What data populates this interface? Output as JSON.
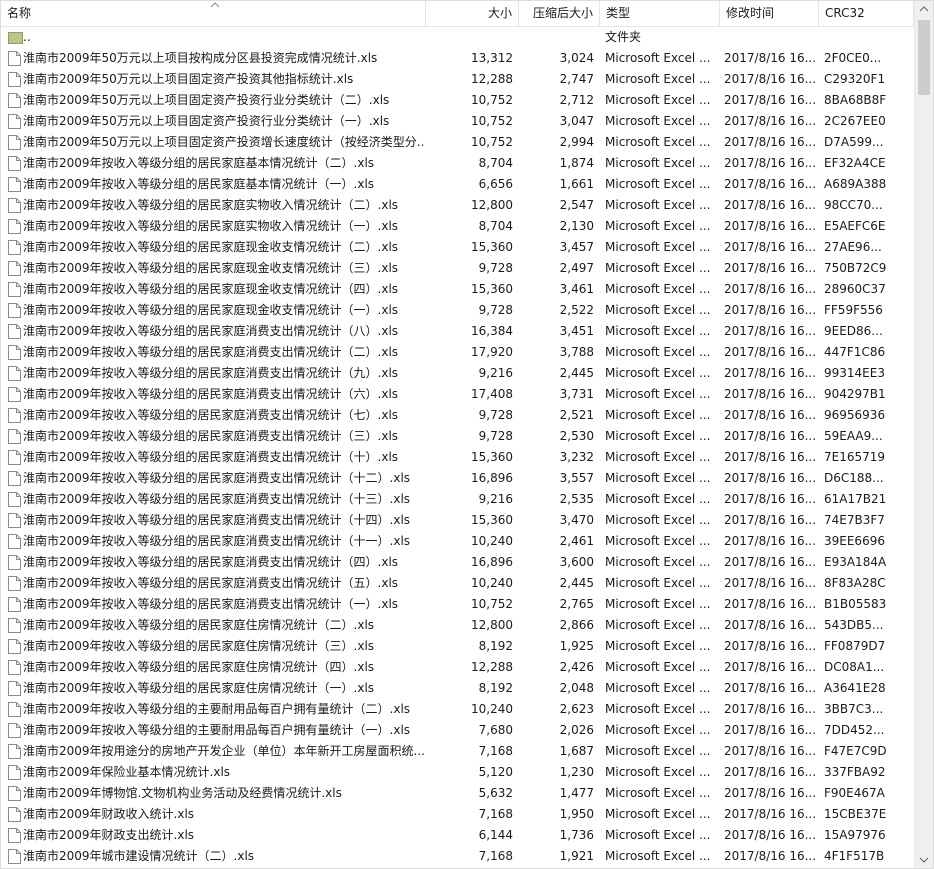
{
  "columns": {
    "name": "名称",
    "size": "大小",
    "compressed": "压缩后大小",
    "type": "类型",
    "modified": "修改时间",
    "crc": "CRC32"
  },
  "parent_row": {
    "name": "..",
    "type": "文件夹"
  },
  "files": [
    {
      "name": "淮南市2009年50万元以上项目按构成分区县投资完成情况统计.xls",
      "size": "13,312",
      "compressed": "3,024",
      "type": "Microsoft Excel ...",
      "modified": "2017/8/16 16...",
      "crc": "2F0CE0..."
    },
    {
      "name": "淮南市2009年50万元以上项目固定资产投资其他指标统计.xls",
      "size": "12,288",
      "compressed": "2,747",
      "type": "Microsoft Excel ...",
      "modified": "2017/8/16 16...",
      "crc": "C29320F1"
    },
    {
      "name": "淮南市2009年50万元以上项目固定资产投资行业分类统计（二）.xls",
      "size": "10,752",
      "compressed": "2,712",
      "type": "Microsoft Excel ...",
      "modified": "2017/8/16 16...",
      "crc": "8BA68B8F"
    },
    {
      "name": "淮南市2009年50万元以上项目固定资产投资行业分类统计（一）.xls",
      "size": "10,752",
      "compressed": "3,047",
      "type": "Microsoft Excel ...",
      "modified": "2017/8/16 16...",
      "crc": "2C267EE0"
    },
    {
      "name": "淮南市2009年50万元以上项目固定资产投资增长速度统计（按经济类型分...",
      "size": "10,752",
      "compressed": "2,994",
      "type": "Microsoft Excel ...",
      "modified": "2017/8/16 16...",
      "crc": "D7A599..."
    },
    {
      "name": "淮南市2009年按收入等级分组的居民家庭基本情况统计（二）.xls",
      "size": "8,704",
      "compressed": "1,874",
      "type": "Microsoft Excel ...",
      "modified": "2017/8/16 16...",
      "crc": "EF32A4CE"
    },
    {
      "name": "淮南市2009年按收入等级分组的居民家庭基本情况统计（一）.xls",
      "size": "6,656",
      "compressed": "1,661",
      "type": "Microsoft Excel ...",
      "modified": "2017/8/16 16...",
      "crc": "A689A388"
    },
    {
      "name": "淮南市2009年按收入等级分组的居民家庭实物收入情况统计（二）.xls",
      "size": "12,800",
      "compressed": "2,547",
      "type": "Microsoft Excel ...",
      "modified": "2017/8/16 16...",
      "crc": "98CC70..."
    },
    {
      "name": "淮南市2009年按收入等级分组的居民家庭实物收入情况统计（一）.xls",
      "size": "8,704",
      "compressed": "2,130",
      "type": "Microsoft Excel ...",
      "modified": "2017/8/16 16...",
      "crc": "E5AEFC6E"
    },
    {
      "name": "淮南市2009年按收入等级分组的居民家庭现金收支情况统计（二）.xls",
      "size": "15,360",
      "compressed": "3,457",
      "type": "Microsoft Excel ...",
      "modified": "2017/8/16 16...",
      "crc": "27AE96..."
    },
    {
      "name": "淮南市2009年按收入等级分组的居民家庭现金收支情况统计（三）.xls",
      "size": "9,728",
      "compressed": "2,497",
      "type": "Microsoft Excel ...",
      "modified": "2017/8/16 16...",
      "crc": "750B72C9"
    },
    {
      "name": "淮南市2009年按收入等级分组的居民家庭现金收支情况统计（四）.xls",
      "size": "15,360",
      "compressed": "3,461",
      "type": "Microsoft Excel ...",
      "modified": "2017/8/16 16...",
      "crc": "28960C37"
    },
    {
      "name": "淮南市2009年按收入等级分组的居民家庭现金收支情况统计（一）.xls",
      "size": "9,728",
      "compressed": "2,522",
      "type": "Microsoft Excel ...",
      "modified": "2017/8/16 16...",
      "crc": "FF59F556"
    },
    {
      "name": "淮南市2009年按收入等级分组的居民家庭消费支出情况统计（八）.xls",
      "size": "16,384",
      "compressed": "3,451",
      "type": "Microsoft Excel ...",
      "modified": "2017/8/16 16...",
      "crc": "9EED86..."
    },
    {
      "name": "淮南市2009年按收入等级分组的居民家庭消费支出情况统计（二）.xls",
      "size": "17,920",
      "compressed": "3,788",
      "type": "Microsoft Excel ...",
      "modified": "2017/8/16 16...",
      "crc": "447F1C86"
    },
    {
      "name": "淮南市2009年按收入等级分组的居民家庭消费支出情况统计（九）.xls",
      "size": "9,216",
      "compressed": "2,445",
      "type": "Microsoft Excel ...",
      "modified": "2017/8/16 16...",
      "crc": "99314EE3"
    },
    {
      "name": "淮南市2009年按收入等级分组的居民家庭消费支出情况统计（六）.xls",
      "size": "17,408",
      "compressed": "3,731",
      "type": "Microsoft Excel ...",
      "modified": "2017/8/16 16...",
      "crc": "904297B1"
    },
    {
      "name": "淮南市2009年按收入等级分组的居民家庭消费支出情况统计（七）.xls",
      "size": "9,728",
      "compressed": "2,521",
      "type": "Microsoft Excel ...",
      "modified": "2017/8/16 16...",
      "crc": "96956936"
    },
    {
      "name": "淮南市2009年按收入等级分组的居民家庭消费支出情况统计（三）.xls",
      "size": "9,728",
      "compressed": "2,530",
      "type": "Microsoft Excel ...",
      "modified": "2017/8/16 16...",
      "crc": "59EAA9..."
    },
    {
      "name": "淮南市2009年按收入等级分组的居民家庭消费支出情况统计（十）.xls",
      "size": "15,360",
      "compressed": "3,232",
      "type": "Microsoft Excel ...",
      "modified": "2017/8/16 16...",
      "crc": "7E165719"
    },
    {
      "name": "淮南市2009年按收入等级分组的居民家庭消费支出情况统计（十二）.xls",
      "size": "16,896",
      "compressed": "3,557",
      "type": "Microsoft Excel ...",
      "modified": "2017/8/16 16...",
      "crc": "D6C188..."
    },
    {
      "name": "淮南市2009年按收入等级分组的居民家庭消费支出情况统计（十三）.xls",
      "size": "9,216",
      "compressed": "2,535",
      "type": "Microsoft Excel ...",
      "modified": "2017/8/16 16...",
      "crc": "61A17B21"
    },
    {
      "name": "淮南市2009年按收入等级分组的居民家庭消费支出情况统计（十四）.xls",
      "size": "15,360",
      "compressed": "3,470",
      "type": "Microsoft Excel ...",
      "modified": "2017/8/16 16...",
      "crc": "74E7B3F7"
    },
    {
      "name": "淮南市2009年按收入等级分组的居民家庭消费支出情况统计（十一）.xls",
      "size": "10,240",
      "compressed": "2,461",
      "type": "Microsoft Excel ...",
      "modified": "2017/8/16 16...",
      "crc": "39EE6696"
    },
    {
      "name": "淮南市2009年按收入等级分组的居民家庭消费支出情况统计（四）.xls",
      "size": "16,896",
      "compressed": "3,600",
      "type": "Microsoft Excel ...",
      "modified": "2017/8/16 16...",
      "crc": "E93A184A"
    },
    {
      "name": "淮南市2009年按收入等级分组的居民家庭消费支出情况统计（五）.xls",
      "size": "10,240",
      "compressed": "2,445",
      "type": "Microsoft Excel ...",
      "modified": "2017/8/16 16...",
      "crc": "8F83A28C"
    },
    {
      "name": "淮南市2009年按收入等级分组的居民家庭消费支出情况统计（一）.xls",
      "size": "10,752",
      "compressed": "2,765",
      "type": "Microsoft Excel ...",
      "modified": "2017/8/16 16...",
      "crc": "B1B05583"
    },
    {
      "name": "淮南市2009年按收入等级分组的居民家庭住房情况统计（二）.xls",
      "size": "12,800",
      "compressed": "2,866",
      "type": "Microsoft Excel ...",
      "modified": "2017/8/16 16...",
      "crc": "543DB5..."
    },
    {
      "name": "淮南市2009年按收入等级分组的居民家庭住房情况统计（三）.xls",
      "size": "8,192",
      "compressed": "1,925",
      "type": "Microsoft Excel ...",
      "modified": "2017/8/16 16...",
      "crc": "FF0879D7"
    },
    {
      "name": "淮南市2009年按收入等级分组的居民家庭住房情况统计（四）.xls",
      "size": "12,288",
      "compressed": "2,426",
      "type": "Microsoft Excel ...",
      "modified": "2017/8/16 16...",
      "crc": "DC08A1..."
    },
    {
      "name": "淮南市2009年按收入等级分组的居民家庭住房情况统计（一）.xls",
      "size": "8,192",
      "compressed": "2,048",
      "type": "Microsoft Excel ...",
      "modified": "2017/8/16 16...",
      "crc": "A3641E28"
    },
    {
      "name": "淮南市2009年按收入等级分组的主要耐用品每百户拥有量统计（二）.xls",
      "size": "10,240",
      "compressed": "2,623",
      "type": "Microsoft Excel ...",
      "modified": "2017/8/16 16...",
      "crc": "3BB7C3..."
    },
    {
      "name": "淮南市2009年按收入等级分组的主要耐用品每百户拥有量统计（一）.xls",
      "size": "7,680",
      "compressed": "2,026",
      "type": "Microsoft Excel ...",
      "modified": "2017/8/16 16...",
      "crc": "7DD452..."
    },
    {
      "name": "淮南市2009年按用途分的房地产开发企业（单位）本年新开工房屋面积统...",
      "size": "7,168",
      "compressed": "1,687",
      "type": "Microsoft Excel ...",
      "modified": "2017/8/16 16...",
      "crc": "F47E7C9D"
    },
    {
      "name": "淮南市2009年保险业基本情况统计.xls",
      "size": "5,120",
      "compressed": "1,230",
      "type": "Microsoft Excel ...",
      "modified": "2017/8/16 16...",
      "crc": "337FBA92"
    },
    {
      "name": "淮南市2009年博物馆.文物机构业务活动及经费情况统计.xls",
      "size": "5,632",
      "compressed": "1,477",
      "type": "Microsoft Excel ...",
      "modified": "2017/8/16 16...",
      "crc": "F90E467A"
    },
    {
      "name": "淮南市2009年财政收入统计.xls",
      "size": "7,168",
      "compressed": "1,950",
      "type": "Microsoft Excel ...",
      "modified": "2017/8/16 16...",
      "crc": "15CBE37E"
    },
    {
      "name": "淮南市2009年财政支出统计.xls",
      "size": "6,144",
      "compressed": "1,736",
      "type": "Microsoft Excel ...",
      "modified": "2017/8/16 16...",
      "crc": "15A97976"
    },
    {
      "name": "淮南市2009年城市建设情况统计（二）.xls",
      "size": "7,168",
      "compressed": "1,921",
      "type": "Microsoft Excel ...",
      "modified": "2017/8/16 16...",
      "crc": "4F1F517B"
    }
  ]
}
